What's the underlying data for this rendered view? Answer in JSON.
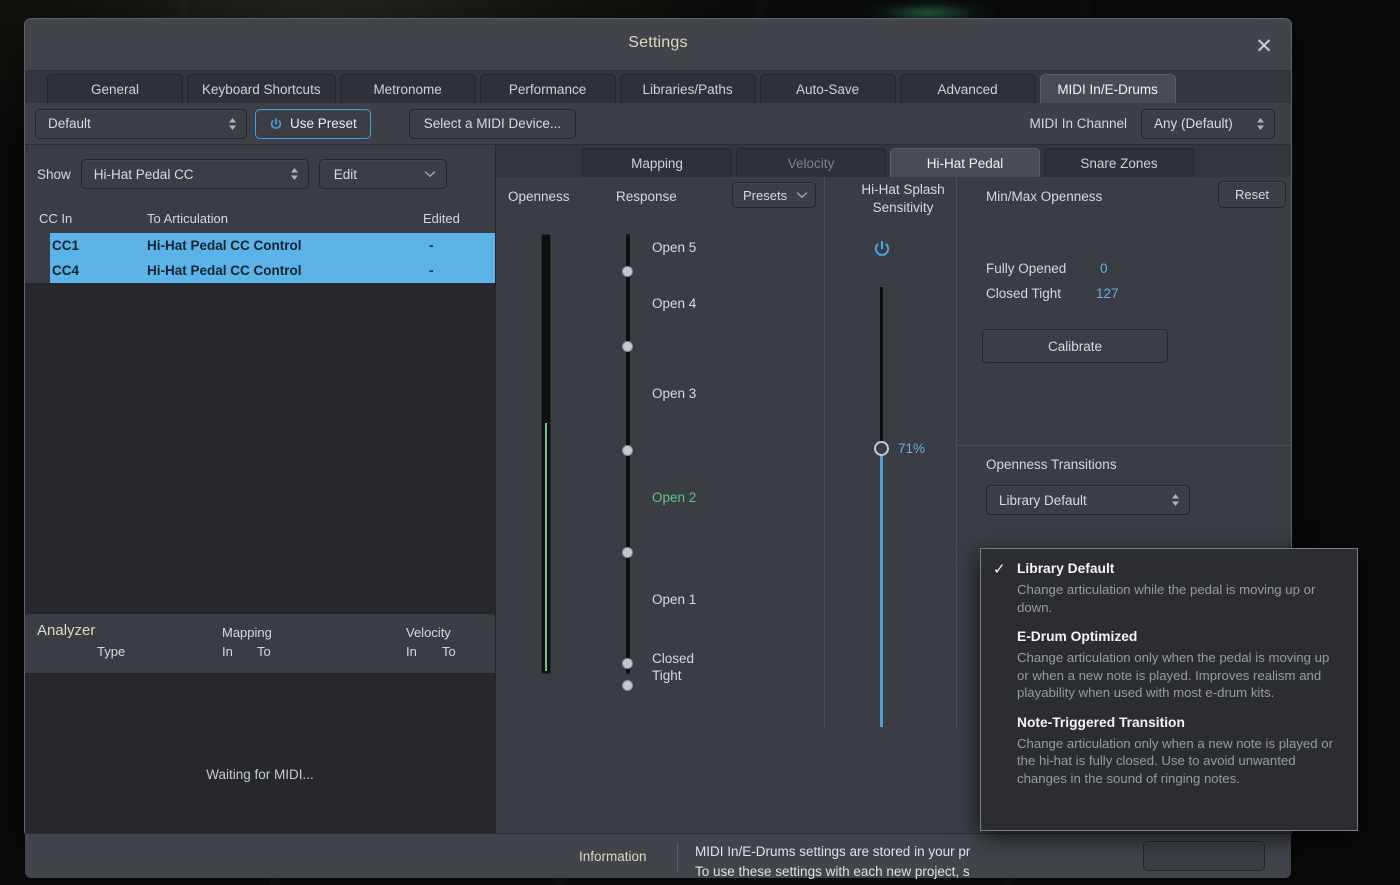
{
  "window": {
    "title": "Settings",
    "close_icon": "close-icon"
  },
  "tabs": [
    {
      "label": "General",
      "active": false
    },
    {
      "label": "Keyboard Shortcuts",
      "active": false
    },
    {
      "label": "Metronome",
      "active": false
    },
    {
      "label": "Performance",
      "active": false
    },
    {
      "label": "Libraries/Paths",
      "active": false
    },
    {
      "label": "Auto-Save",
      "active": false
    },
    {
      "label": "Advanced",
      "active": false
    },
    {
      "label": "MIDI In/E-Drums",
      "active": true
    }
  ],
  "preset_row": {
    "preset_value": "Default",
    "use_preset_label": "Use Preset",
    "power_icon": "power-icon",
    "midi_device_label": "Select a MIDI Device...",
    "midi_in_channel_label": "MIDI In Channel",
    "midi_in_channel_value": "Any (Default)"
  },
  "left_pane": {
    "show_label": "Show",
    "show_value": "Hi-Hat Pedal CC",
    "edit_label": "Edit",
    "columns": {
      "cc_in": "CC In",
      "to_articulation": "To Articulation",
      "edited": "Edited"
    },
    "rows": [
      {
        "cc": "CC1",
        "articulation": "Hi-Hat Pedal CC Control",
        "edited": "-",
        "selected": true
      },
      {
        "cc": "CC4",
        "articulation": "Hi-Hat Pedal CC Control",
        "edited": "-",
        "selected": true
      }
    ],
    "analyzer": {
      "title": "Analyzer",
      "type_label": "Type",
      "mapping_label": "Mapping",
      "velocity_label": "Velocity",
      "mapping_in": "In",
      "mapping_to": "To",
      "velocity_in": "In",
      "velocity_to": "To",
      "status": "Waiting for MIDI..."
    }
  },
  "right_pane": {
    "subtabs": [
      {
        "label": "Mapping",
        "active": false,
        "dim": false
      },
      {
        "label": "Velocity",
        "active": false,
        "dim": true
      },
      {
        "label": "Hi-Hat Pedal",
        "active": true,
        "dim": false
      },
      {
        "label": "Snare Zones",
        "active": false,
        "dim": false
      }
    ],
    "openness_label": "Openness",
    "response_label": "Response",
    "presets_label": "Presets",
    "splash_label": "Hi-Hat Splash\nSensitivity",
    "splash_power_icon": "power-icon",
    "splash_value": "71%",
    "response_steps": [
      {
        "label": "Open 5",
        "highlight": false
      },
      {
        "label": "Open 4",
        "highlight": false
      },
      {
        "label": "Open 3",
        "highlight": false
      },
      {
        "label": "Open 2",
        "highlight": true
      },
      {
        "label": "Open 1",
        "highlight": false
      },
      {
        "label": "Closed\nTight",
        "highlight": false
      }
    ],
    "minmax": {
      "title": "Min/Max Openness",
      "reset_label": "Reset",
      "fully_opened_label": "Fully Opened",
      "fully_opened_value": "0",
      "closed_tight_label": "Closed Tight",
      "closed_tight_value": "127",
      "calibrate_label": "Calibrate"
    },
    "transitions": {
      "title": "Openness Transitions",
      "selected": "Library Default",
      "options": [
        {
          "name": "Library Default",
          "description": "Change articulation while the pedal is moving up or down.",
          "checked": true
        },
        {
          "name": "E-Drum Optimized",
          "description": "Change articulation only when the pedal is moving up or when a new note is played. Improves realism and playability when used with most e-drum kits.",
          "checked": false
        },
        {
          "name": "Note-Triggered Transition",
          "description": "Change articulation only when a new note is played or the hi-hat is fully closed. Use to avoid unwanted changes in the sound of ringing notes.",
          "checked": false
        }
      ]
    }
  },
  "info_bar": {
    "label": "Information",
    "text": "MIDI In/E-Drums settings are stored in your pr\nTo use these settings with each new project, s",
    "ok_label": ""
  },
  "colors": {
    "accent_blue": "#5cb3e8",
    "selection_blue": "#5cb3e8",
    "value_blue": "#67b0e0",
    "highlight_green": "#62c487",
    "meter_green": "#6cc48b",
    "title_gold": "#ddd9c0",
    "window_bg": "#3a3d44",
    "pane_bg": "#2e3137",
    "list_bg": "#26282d"
  }
}
